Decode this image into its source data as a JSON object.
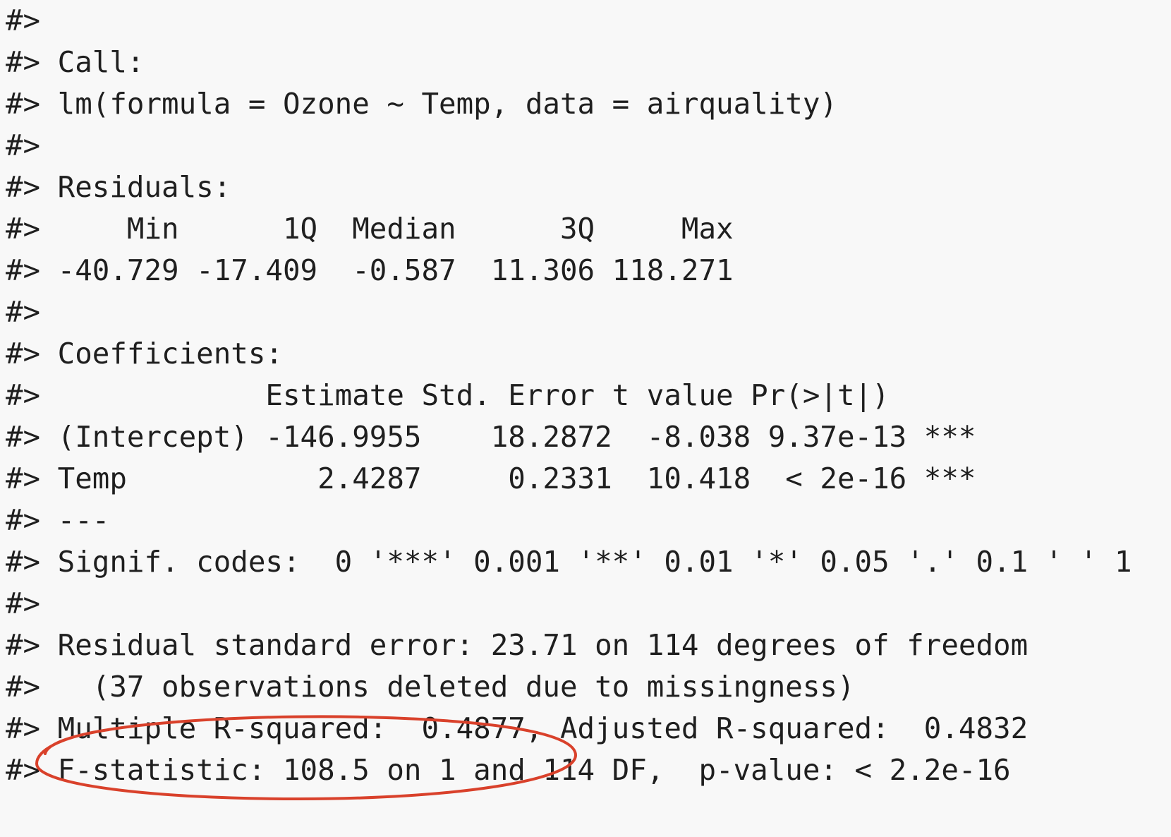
{
  "console": {
    "lines": [
      "#>",
      "#> Call:",
      "#> lm(formula = Ozone ~ Temp, data = airquality)",
      "#>",
      "#> Residuals:",
      "#>     Min      1Q  Median      3Q     Max",
      "#> -40.729 -17.409  -0.587  11.306 118.271",
      "#>",
      "#> Coefficients:",
      "#>             Estimate Std. Error t value Pr(>|t|)",
      "#> (Intercept) -146.9955    18.2872  -8.038 9.37e-13 ***",
      "#> Temp           2.4287     0.2331  10.418  < 2e-16 ***",
      "#> ---",
      "#> Signif. codes:  0 '***' 0.001 '**' 0.01 '*' 0.05 '.' 0.1 ' ' 1",
      "#>",
      "#> Residual standard error: 23.71 on 114 degrees of freedom",
      "#>   (37 observations deleted due to missingness)",
      "#> Multiple R-squared:  0.4877,\tAdjusted R-squared:  0.4832",
      "#> F-statistic: 108.5 on 1 and 114 DF,  p-value: < 2.2e-16"
    ]
  },
  "annotation": {
    "color": "#d9412b"
  }
}
